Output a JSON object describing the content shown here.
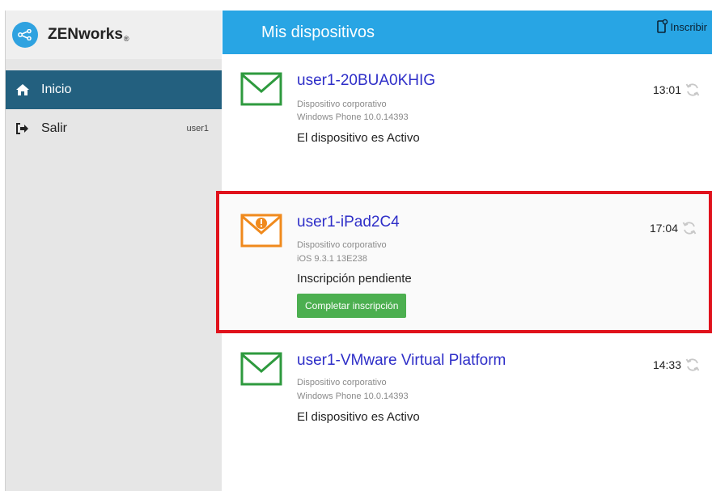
{
  "brand": {
    "name": "ZENworks",
    "mark": "®",
    "logo_icon": "share-icon"
  },
  "sidebar": {
    "items": [
      {
        "label": "Inicio",
        "icon": "home-icon"
      },
      {
        "label": "Salir",
        "icon": "sign-out-icon",
        "user": "user1"
      }
    ]
  },
  "header": {
    "title": "Mis dispositivos",
    "enroll_label": "Inscribir",
    "enroll_icon": "enroll-device-icon"
  },
  "devices": [
    {
      "name": "user1-20BUA0KHIG",
      "type": "Dispositivo corporativo",
      "os": "Windows Phone 10.0.14393",
      "status": "El dispositivo es Activo",
      "time": "13:01",
      "icon_color": "#2e9a3e"
    },
    {
      "name": "user1-iPad2C4",
      "type": "Dispositivo corporativo",
      "os": "iOS 9.3.1 13E238",
      "status": "Inscripción pendiente",
      "time": "17:04",
      "button": "Completar inscripción",
      "icon_color": "#f08a1d"
    },
    {
      "name": "user1-VMware Virtual Platform",
      "type": "Dispositivo corporativo",
      "os": "Windows Phone 10.0.14393",
      "status": "El dispositivo es Activo",
      "time": "14:33",
      "icon_color": "#2e9a3e"
    }
  ],
  "colors": {
    "header": "#28a5e4",
    "active_nav": "#23607f",
    "highlight": "#e0121c",
    "button": "#4caf50",
    "link": "#2e2ec8"
  }
}
